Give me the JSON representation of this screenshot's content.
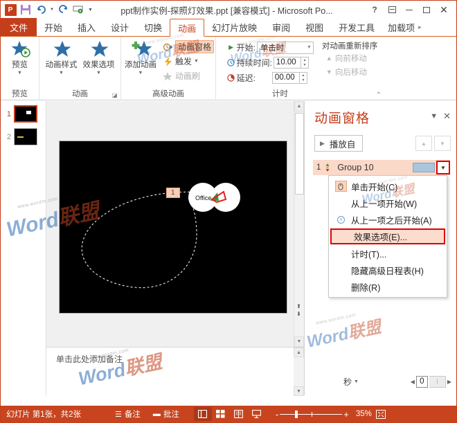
{
  "window": {
    "title": "ppt制作实例-探照灯效果.ppt [兼容模式] - Microsoft Po...",
    "qat": {
      "logo": "P",
      "save_icon": "save-icon",
      "undo_icon": "undo-icon",
      "redo_icon": "redo-icon",
      "slideshow_icon": "start-slideshow-icon",
      "customize_icon": "customize-qat-icon"
    },
    "controls": {
      "help": "?",
      "ribbon_display": "ribbon-display-options-icon",
      "minimize": "minimize-icon",
      "maximize": "maximize-icon",
      "close": "✕"
    }
  },
  "tabs": [
    {
      "label": "文件",
      "active": false,
      "is_file": true
    },
    {
      "label": "开始",
      "active": false
    },
    {
      "label": "插入",
      "active": false
    },
    {
      "label": "设计",
      "active": false
    },
    {
      "label": "切换",
      "active": false
    },
    {
      "label": "动画",
      "active": true
    },
    {
      "label": "幻灯片放映",
      "active": false
    },
    {
      "label": "审阅",
      "active": false
    },
    {
      "label": "视图",
      "active": false
    },
    {
      "label": "开发工具",
      "active": false
    },
    {
      "label": "加载项",
      "active": false
    }
  ],
  "ribbon": {
    "groups": {
      "preview": {
        "label": "预览",
        "button": "预览"
      },
      "animation": {
        "label": "动画",
        "styles": "动画样式",
        "effect_options": "效果选项",
        "dialog_launcher": "animation-dialog-launcher"
      },
      "advanced": {
        "label": "高级动画",
        "add_animation": "添加动画",
        "animation_pane": "动画窗格",
        "trigger": "触发",
        "animation_painter": "动画刷"
      },
      "timing": {
        "label": "计时",
        "start_label": "开始:",
        "start_value": "单击时",
        "duration_label": "持续时间:",
        "duration_value": "10.00",
        "delay_label": "延迟:",
        "delay_value": "00.00",
        "reorder_label": "对动画重新排序",
        "move_earlier": "向前移动",
        "move_later": "向后移动"
      }
    },
    "collapse_icon": "collapse-ribbon-icon"
  },
  "thumbnails": [
    {
      "number": "1",
      "active": true
    },
    {
      "number": "2",
      "active": false
    }
  ],
  "slide": {
    "anim_marker": "1",
    "shape_text": "Office",
    "background_color": "#000000",
    "path_style": "dashed-motion-path"
  },
  "notes": {
    "placeholder": "单击此处添加备注"
  },
  "animation_pane": {
    "title": "动画窗格",
    "collapse_icon": "chevron-down-icon",
    "close_icon": "close-icon",
    "play_button": "播放自",
    "move_up_icon": "move-up-icon",
    "move_down_icon": "move-down-icon",
    "rows": [
      {
        "number": "1",
        "name": "Group 10",
        "selected": true
      }
    ],
    "seconds_label": "秒",
    "scroll_value": "0"
  },
  "context_menu": {
    "items": [
      {
        "label": "单击开始(C)",
        "icon": "mouse-click-icon",
        "selected": false
      },
      {
        "label": "从上一项开始(W)",
        "icon": "",
        "selected": false
      },
      {
        "label": "从上一项之后开始(A)",
        "icon": "clock-icon",
        "selected": false
      },
      {
        "label": "效果选项(E)...",
        "icon": "",
        "selected": true
      },
      {
        "label": "计时(T)...",
        "icon": "",
        "selected": false
      },
      {
        "label": "隐藏高级日程表(H)",
        "icon": "",
        "selected": false
      },
      {
        "label": "删除(R)",
        "icon": "",
        "selected": false
      }
    ]
  },
  "statusbar": {
    "slide_info": "幻灯片 第1张，共2张",
    "notes_button": "备注",
    "comments_button": "批注",
    "views": [
      "normal-view-icon",
      "slide-sorter-icon",
      "reading-view-icon",
      "slideshow-icon"
    ],
    "zoom_out": "-",
    "zoom_in": "+",
    "zoom_percent": "35%",
    "fit_icon": "fit-slide-icon"
  },
  "watermark": {
    "brand": "Word",
    "brand2": "联盟",
    "url": "www.wordm.com"
  },
  "colors": {
    "accent": "#c43e1c",
    "status_bar": "#c7441f",
    "highlight": "#fbd9c8",
    "selection_red": "#e00000",
    "timeline_bar": "#a8c6dd"
  }
}
